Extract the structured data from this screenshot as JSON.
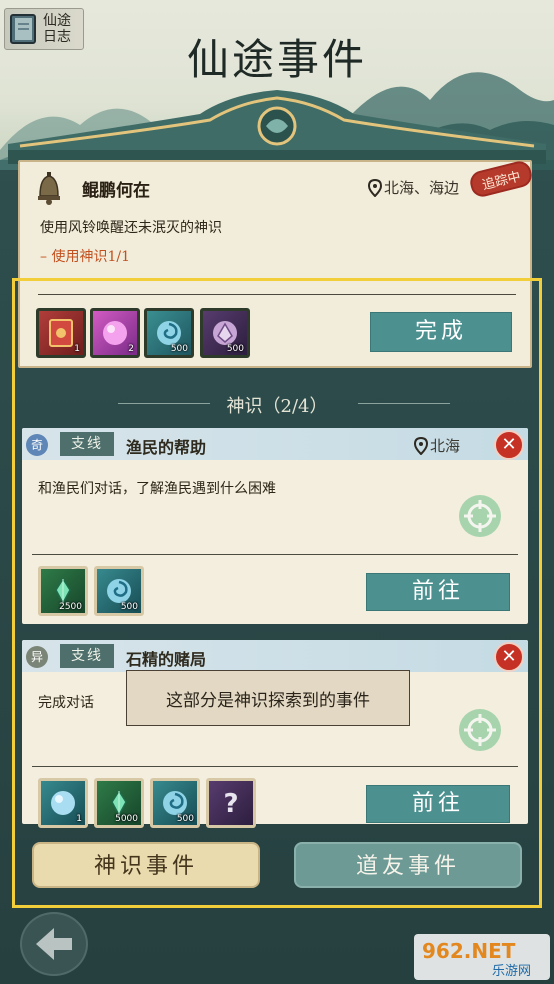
{
  "header": {
    "journal_label_1": "仙途",
    "journal_label_2": "日志",
    "title": "仙途事件"
  },
  "main_quest": {
    "title": "鲲鹏何在",
    "location": "北海、海边",
    "stamp": "追踪中",
    "description": "使用风铃唤醒还未泯灭的神识",
    "task": "– 使用神识1/1",
    "rewards": [
      {
        "icon": "red-book-icon",
        "qty": "1"
      },
      {
        "icon": "pink-orb-icon",
        "qty": "2"
      },
      {
        "icon": "blue-swirl-icon",
        "qty": "500"
      },
      {
        "icon": "purple-crystal-icon",
        "qty": "500"
      }
    ],
    "complete_label": "完成"
  },
  "section": {
    "title": "神识（2/4）"
  },
  "subquests": [
    {
      "badge": "奇",
      "tag": "支线",
      "title": "渔民的帮助",
      "location": "北海",
      "description": "和渔民们对话，了解渔民遇到什么困难",
      "rewards": [
        {
          "icon": "green-crystal-icon",
          "qty": "2500"
        },
        {
          "icon": "blue-swirl-icon",
          "qty": "500"
        }
      ],
      "go_label": "前往"
    },
    {
      "badge": "异",
      "tag": "支线",
      "title": "石精的赌局",
      "location": "",
      "description": "完成对话",
      "rewards": [
        {
          "icon": "blue-orb-icon",
          "qty": "1"
        },
        {
          "icon": "green-crystal-icon",
          "qty": "5000"
        },
        {
          "icon": "blue-swirl-icon",
          "qty": "500"
        },
        {
          "icon": "question-mark-icon",
          "qty": ""
        }
      ],
      "go_label": "前往"
    }
  ],
  "tooltip": "这部分是神识探索到的事件",
  "tabs": {
    "active": "神识事件",
    "other": "道友事件"
  },
  "watermark": {
    "line1": "962.NET",
    "line2": "乐游网"
  }
}
